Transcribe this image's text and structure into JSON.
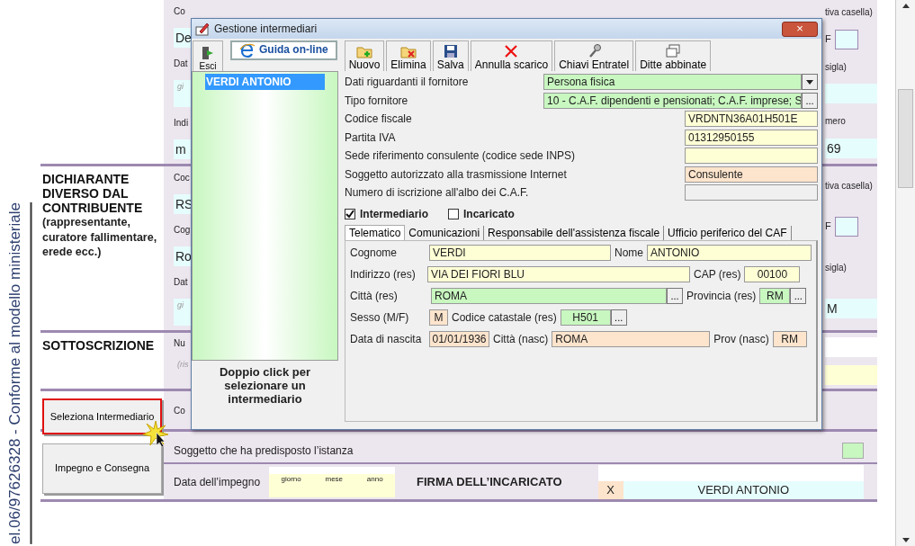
{
  "form": {
    "vertical_label": "el.06/97626328 - Conforme al modello ministeriale",
    "sections": [
      {
        "kind": "fields",
        "left": [
          {
            "kind": "label",
            "text": "Co"
          },
          {
            "kind": "field",
            "text": "De",
            "color": "#e6fdfd"
          },
          {
            "kind": "label",
            "text": "Dat"
          },
          {
            "kind": "hint",
            "text": "gi",
            "color": "#e6fdfd"
          },
          {
            "kind": "label",
            "text": "Indi"
          },
          {
            "kind": "field",
            "text": "m",
            "color": "#e6fdfd"
          }
        ],
        "right": [
          {
            "kind": "label",
            "text": "tiva casella)"
          },
          {
            "kind": "check",
            "text": "F",
            "checked": false
          },
          {
            "kind": "label",
            "text": "sigla)"
          },
          {
            "kind": "field",
            "color": "#e6fdfd"
          },
          {
            "kind": "label",
            "text": "mero"
          },
          {
            "kind": "field",
            "text": "69",
            "color": "#e6fdfd"
          }
        ]
      },
      {
        "kind": "fields",
        "title": "DICHIARANTE DIVERSO DAL CONTRIBUENTE",
        "subtitle": "(rappresentante, curatore fallimentare, erede ecc.)",
        "left": [
          {
            "kind": "label",
            "text": "Coc"
          },
          {
            "kind": "field",
            "text": "RS",
            "color": "#e6fdfd"
          },
          {
            "kind": "label",
            "text": "Cog"
          },
          {
            "kind": "field",
            "text": "Ro",
            "color": "#e6fdfd"
          },
          {
            "kind": "label",
            "text": "Dat"
          },
          {
            "kind": "hint",
            "text": "gi",
            "color": "#e6fdfd"
          }
        ],
        "right": [
          {
            "kind": "label",
            "text": "tiva casella)"
          },
          {
            "kind": "check",
            "text": "F",
            "checked": false
          },
          {
            "kind": "label",
            "text": "sigla)"
          },
          {
            "kind": "field",
            "text": "M",
            "color": "#e6fdfd"
          }
        ]
      },
      {
        "kind": "fields",
        "title": "SOTTOSCRIZIONE",
        "left": [
          {
            "kind": "label",
            "text": "Nu"
          },
          {
            "kind": "hint",
            "text": "(ris"
          }
        ],
        "right": [
          {
            "kind": "field",
            "color": "#ffffff"
          },
          {
            "kind": "field",
            "color": "#ffffd6"
          }
        ]
      },
      {
        "kind": "action",
        "button": {
          "label": "Seleziona Intermediario",
          "highlighted": true
        },
        "left": [
          {
            "kind": "label",
            "text": "Co"
          }
        ]
      },
      {
        "kind": "closing",
        "button": {
          "label": "Impegno e Consegna",
          "highlighted": false
        },
        "preparer_label": "Soggetto che ha predisposto l’istanza",
        "date_label": "Data dell’impegno",
        "date_parts": [
          "giorno",
          "mese",
          "anno"
        ],
        "signature_title": "FIRMA DELL’INCARICATO",
        "mark": "X",
        "signer": "VERDI ANTONIO"
      }
    ]
  },
  "dialog": {
    "title": "Gestione intermediari",
    "close": "×",
    "toolbar": [
      {
        "label": "Esci",
        "kind": "exit"
      },
      {
        "label": "Guida on-line",
        "kind": "help"
      },
      {
        "label": "Nuovo",
        "kind": "new"
      },
      {
        "label": "Elimina",
        "kind": "delete"
      },
      {
        "label": "Salva",
        "kind": "save"
      },
      {
        "label": "Annulla scarico",
        "kind": "cancel"
      },
      {
        "label": "Chiavi Entratel",
        "kind": "key"
      },
      {
        "label": "Ditte abbinate",
        "kind": "windows"
      }
    ],
    "list": {
      "items": [
        {
          "text": "VERDI ANTONIO",
          "selected": true
        }
      ],
      "hint": "Doppio click per selezionare un intermediario"
    },
    "supplier_fields": [
      {
        "kind": "select",
        "label": "Dati riguardanti il fornitore",
        "value": "Persona fisica",
        "color": "#c8f7c0"
      },
      {
        "kind": "lookup",
        "label": "Tipo fornitore",
        "value": "10 - C.A.F. dipendenti e pensionati; C.A.F. imprese; S",
        "color": "#c8f7c0",
        "button": "..."
      },
      {
        "kind": "text",
        "label": "Codice fiscale",
        "value": "VRDNTN36A01H501E",
        "color": "#ffffd6"
      },
      {
        "kind": "text",
        "label": "Partita IVA",
        "value": "01312950155",
        "color": "#ffffd6"
      },
      {
        "kind": "text",
        "label": "Sede riferimento consulente (codice sede INPS)",
        "color": "#ffffd6"
      },
      {
        "kind": "text",
        "label": "Soggetto autorizzato alla trasmissione Internet",
        "value": "Consulente",
        "color": "#fde4cc"
      },
      {
        "kind": "text",
        "label": "Numero di iscrizione all'albo dei C.A.F.",
        "color": "#f0f0f0"
      }
    ],
    "checkboxes": [
      {
        "label": "Intermediario",
        "checked": true
      },
      {
        "label": "Incaricato",
        "checked": false
      }
    ],
    "tabs": [
      {
        "label": "Telematico",
        "selected": true
      },
      {
        "label": "Comunicazioni",
        "selected": false
      },
      {
        "label": "Responsabile dell'assistenza fiscale",
        "selected": false
      },
      {
        "label": "Ufficio periferico del CAF",
        "selected": false
      }
    ],
    "tab_rows": [
      [
        {
          "kind": "label",
          "text": "Cognome"
        },
        {
          "kind": "field",
          "value": "VERDI",
          "color": "#ffffd6"
        },
        {
          "kind": "label",
          "text": "Nome"
        },
        {
          "kind": "field",
          "value": "ANTONIO",
          "color": "#ffffd6"
        }
      ],
      [
        {
          "kind": "label",
          "text": "Indirizzo (res)"
        },
        {
          "kind": "field",
          "value": "VIA DEI FIORI BLU",
          "color": "#ffffd6"
        },
        {
          "kind": "label",
          "text": "CAP (res)"
        },
        {
          "kind": "field",
          "value": "00100",
          "color": "#ffffd6"
        }
      ],
      [
        {
          "kind": "label",
          "text": "Città (res)"
        },
        {
          "kind": "field",
          "value": "ROMA",
          "color": "#c8f7c0",
          "button": "..."
        },
        {
          "kind": "label",
          "text": "Provincia (res)"
        },
        {
          "kind": "field",
          "value": "RM",
          "color": "#c8f7c0",
          "button": "..."
        }
      ],
      [
        {
          "kind": "label",
          "text": "Sesso (M/F)"
        },
        {
          "kind": "field",
          "value": "M",
          "color": "#fde4cc"
        },
        {
          "kind": "label",
          "text": "Codice catastale (res)"
        },
        {
          "kind": "field",
          "value": "H501",
          "color": "#c8f7c0",
          "button": "..."
        }
      ],
      [
        {
          "kind": "label",
          "text": "Data di nascita"
        },
        {
          "kind": "field",
          "value": "01/01/1936",
          "color": "#fde4cc"
        },
        {
          "kind": "label",
          "text": "Città (nasc)"
        },
        {
          "kind": "field",
          "value": "ROMA",
          "color": "#fde4cc"
        },
        {
          "kind": "label",
          "text": "Prov (nasc)"
        },
        {
          "kind": "field",
          "value": "RM",
          "color": "#fde4cc"
        }
      ]
    ]
  }
}
